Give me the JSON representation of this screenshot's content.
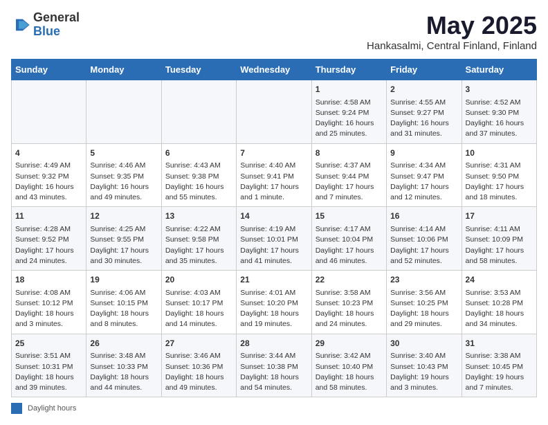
{
  "header": {
    "logo_general": "General",
    "logo_blue": "Blue",
    "title": "May 2025",
    "subtitle": "Hankasalmi, Central Finland, Finland"
  },
  "days_of_week": [
    "Sunday",
    "Monday",
    "Tuesday",
    "Wednesday",
    "Thursday",
    "Friday",
    "Saturday"
  ],
  "weeks": [
    [
      {
        "day": "",
        "content": ""
      },
      {
        "day": "",
        "content": ""
      },
      {
        "day": "",
        "content": ""
      },
      {
        "day": "",
        "content": ""
      },
      {
        "day": "1",
        "content": "Sunrise: 4:58 AM\nSunset: 9:24 PM\nDaylight: 16 hours\nand 25 minutes."
      },
      {
        "day": "2",
        "content": "Sunrise: 4:55 AM\nSunset: 9:27 PM\nDaylight: 16 hours\nand 31 minutes."
      },
      {
        "day": "3",
        "content": "Sunrise: 4:52 AM\nSunset: 9:30 PM\nDaylight: 16 hours\nand 37 minutes."
      }
    ],
    [
      {
        "day": "4",
        "content": "Sunrise: 4:49 AM\nSunset: 9:32 PM\nDaylight: 16 hours\nand 43 minutes."
      },
      {
        "day": "5",
        "content": "Sunrise: 4:46 AM\nSunset: 9:35 PM\nDaylight: 16 hours\nand 49 minutes."
      },
      {
        "day": "6",
        "content": "Sunrise: 4:43 AM\nSunset: 9:38 PM\nDaylight: 16 hours\nand 55 minutes."
      },
      {
        "day": "7",
        "content": "Sunrise: 4:40 AM\nSunset: 9:41 PM\nDaylight: 17 hours\nand 1 minute."
      },
      {
        "day": "8",
        "content": "Sunrise: 4:37 AM\nSunset: 9:44 PM\nDaylight: 17 hours\nand 7 minutes."
      },
      {
        "day": "9",
        "content": "Sunrise: 4:34 AM\nSunset: 9:47 PM\nDaylight: 17 hours\nand 12 minutes."
      },
      {
        "day": "10",
        "content": "Sunrise: 4:31 AM\nSunset: 9:50 PM\nDaylight: 17 hours\nand 18 minutes."
      }
    ],
    [
      {
        "day": "11",
        "content": "Sunrise: 4:28 AM\nSunset: 9:52 PM\nDaylight: 17 hours\nand 24 minutes."
      },
      {
        "day": "12",
        "content": "Sunrise: 4:25 AM\nSunset: 9:55 PM\nDaylight: 17 hours\nand 30 minutes."
      },
      {
        "day": "13",
        "content": "Sunrise: 4:22 AM\nSunset: 9:58 PM\nDaylight: 17 hours\nand 35 minutes."
      },
      {
        "day": "14",
        "content": "Sunrise: 4:19 AM\nSunset: 10:01 PM\nDaylight: 17 hours\nand 41 minutes."
      },
      {
        "day": "15",
        "content": "Sunrise: 4:17 AM\nSunset: 10:04 PM\nDaylight: 17 hours\nand 46 minutes."
      },
      {
        "day": "16",
        "content": "Sunrise: 4:14 AM\nSunset: 10:06 PM\nDaylight: 17 hours\nand 52 minutes."
      },
      {
        "day": "17",
        "content": "Sunrise: 4:11 AM\nSunset: 10:09 PM\nDaylight: 17 hours\nand 58 minutes."
      }
    ],
    [
      {
        "day": "18",
        "content": "Sunrise: 4:08 AM\nSunset: 10:12 PM\nDaylight: 18 hours\nand 3 minutes."
      },
      {
        "day": "19",
        "content": "Sunrise: 4:06 AM\nSunset: 10:15 PM\nDaylight: 18 hours\nand 8 minutes."
      },
      {
        "day": "20",
        "content": "Sunrise: 4:03 AM\nSunset: 10:17 PM\nDaylight: 18 hours\nand 14 minutes."
      },
      {
        "day": "21",
        "content": "Sunrise: 4:01 AM\nSunset: 10:20 PM\nDaylight: 18 hours\nand 19 minutes."
      },
      {
        "day": "22",
        "content": "Sunrise: 3:58 AM\nSunset: 10:23 PM\nDaylight: 18 hours\nand 24 minutes."
      },
      {
        "day": "23",
        "content": "Sunrise: 3:56 AM\nSunset: 10:25 PM\nDaylight: 18 hours\nand 29 minutes."
      },
      {
        "day": "24",
        "content": "Sunrise: 3:53 AM\nSunset: 10:28 PM\nDaylight: 18 hours\nand 34 minutes."
      }
    ],
    [
      {
        "day": "25",
        "content": "Sunrise: 3:51 AM\nSunset: 10:31 PM\nDaylight: 18 hours\nand 39 minutes."
      },
      {
        "day": "26",
        "content": "Sunrise: 3:48 AM\nSunset: 10:33 PM\nDaylight: 18 hours\nand 44 minutes."
      },
      {
        "day": "27",
        "content": "Sunrise: 3:46 AM\nSunset: 10:36 PM\nDaylight: 18 hours\nand 49 minutes."
      },
      {
        "day": "28",
        "content": "Sunrise: 3:44 AM\nSunset: 10:38 PM\nDaylight: 18 hours\nand 54 minutes."
      },
      {
        "day": "29",
        "content": "Sunrise: 3:42 AM\nSunset: 10:40 PM\nDaylight: 18 hours\nand 58 minutes."
      },
      {
        "day": "30",
        "content": "Sunrise: 3:40 AM\nSunset: 10:43 PM\nDaylight: 19 hours\nand 3 minutes."
      },
      {
        "day": "31",
        "content": "Sunrise: 3:38 AM\nSunset: 10:45 PM\nDaylight: 19 hours\nand 7 minutes."
      }
    ]
  ],
  "legend": {
    "label": "Daylight hours"
  }
}
